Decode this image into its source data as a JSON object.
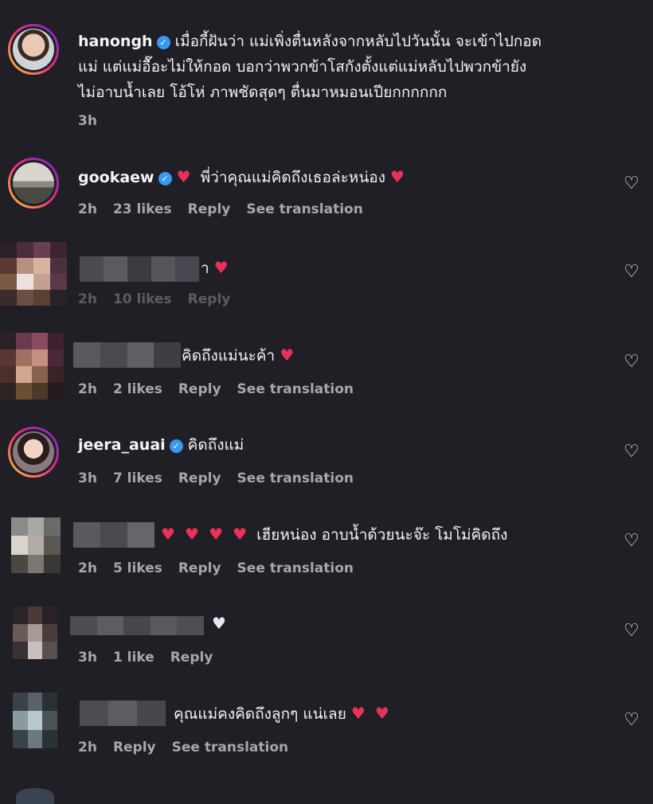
{
  "comments": [
    {
      "username": "hanongh",
      "verified": true,
      "text": "เมื่อกี้ฝันว่า แม่เพิ่งตื่นหลังจากหลับไปวันนั้น จะเข้าไปกอด",
      "text2": "แม่ แต่แม่อื๊อะไม่ให้กอด บอกว่าพวกข้าโสกังตั้งแต่แม่หลับไปพวกข้ายัง",
      "text3": "ไม่อาบน้ำเลย โอ้โห่ ภาพชัดสุดๆ ตื่นมาหมอนเปียกกกกกก",
      "time": "3h"
    },
    {
      "username": "gookaew",
      "verified": true,
      "text": "พี่ว่าคุณแม่คิดถึงเธอล่ะหน่อง",
      "time": "2h",
      "likes": "23 likes",
      "reply": "Reply",
      "translate": "See translation"
    },
    {
      "text": "า",
      "time": "2h",
      "likes": "10 likes",
      "reply": "Reply"
    },
    {
      "text": "คิดถึงแม่นะค้า",
      "time": "2h",
      "likes": "2 likes",
      "reply": "Reply",
      "translate": "See translation"
    },
    {
      "username": "jeera_auai",
      "verified": true,
      "text": "คิดถึงแม่",
      "time": "3h",
      "likes": "7 likes",
      "reply": "Reply",
      "translate": "See translation"
    },
    {
      "text": "เฮียหน่อง อาบน้ำด้วยนะจ๊ะ โมโม่คิดถึง",
      "time": "2h",
      "likes": "5 likes",
      "reply": "Reply",
      "translate": "See translation"
    },
    {
      "time": "3h",
      "likes": "1 like",
      "reply": "Reply"
    },
    {
      "text": "คุณแม่คงคิดถึงลูกๆ แน่เลย",
      "time": "2h",
      "reply": "Reply",
      "translate": "See translation"
    }
  ],
  "icons": {
    "heart": "heart-outline-icon",
    "verified": "verified-badge-icon"
  },
  "colors": {
    "background": "#1f1f25",
    "verified": "#3897f0",
    "heart": "#e8325a",
    "meta": "#a8a8a8"
  }
}
